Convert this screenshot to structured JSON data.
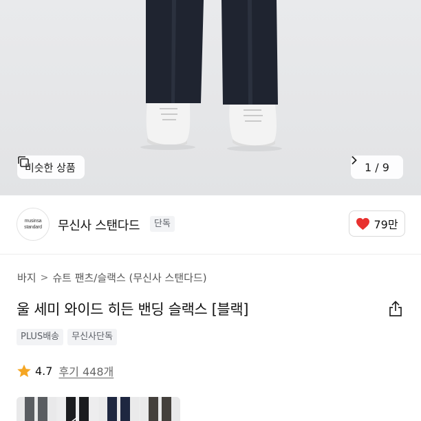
{
  "hero": {
    "similar_label": "비슷한 상품",
    "counter": "1 / 9",
    "similar_icon": "similar-items-icon",
    "next_icon": "chevron-right-icon"
  },
  "brand": {
    "logo_line1": "musinsa",
    "logo_line2": "standard",
    "name": "무신사 스탠다드",
    "badge": "단독"
  },
  "like": {
    "count": "79만",
    "icon": "heart-icon",
    "color": "#e8312f"
  },
  "breadcrumb": {
    "items": [
      "바지",
      "슈트 팬츠/슬랙스 (무신사 스탠다드)"
    ],
    "separator": ">"
  },
  "product": {
    "title": "울 세미 와이드 히든 밴딩 슬랙스 [블랙]",
    "share_icon": "share-icon"
  },
  "tags": [
    "PLUS배송",
    "무신사단독"
  ],
  "rating": {
    "score": "4.7",
    "reviews": "후기 448개",
    "star_color": "#f5a623"
  },
  "colors": {
    "hero_bg": "#e7e8ea",
    "tag_bg": "#f2f3f5",
    "text_primary": "#111111",
    "text_secondary": "#5b5f66"
  }
}
